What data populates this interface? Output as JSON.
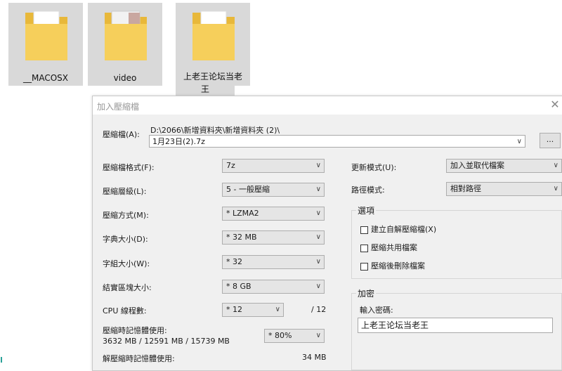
{
  "desktop": {
    "folders": [
      {
        "name": "__MACOSX"
      },
      {
        "name": "video"
      },
      {
        "name": "上老王论坛当老",
        "name_line2": "王"
      }
    ]
  },
  "dialog": {
    "title": "加入壓縮檔",
    "close_glyph": "✕",
    "archive_label": "壓縮檔(A):",
    "archive_path": "D:\\2066\\新增資料夾\\新增資料夾 (2)\\",
    "archive_name": "1月23日(2).7z",
    "browse_label": "...",
    "format_label": "壓縮檔格式(F):",
    "format_value": "7z",
    "level_label": "壓縮層級(L):",
    "level_value": "5 - 一般壓縮",
    "method_label": "壓縮方式(M):",
    "method_value": "* LZMA2",
    "dict_label": "字典大小(D):",
    "dict_value": "* 32 MB",
    "word_label": "字組大小(W):",
    "word_value": "* 32",
    "solid_label": "結實區塊大小:",
    "solid_value": "* 8 GB",
    "cpu_label": "CPU 線程數:",
    "cpu_value": "* 12",
    "cpu_total": "/ 12",
    "mem_label": "壓縮時記憶體使用:",
    "mem_detail": "3632 MB / 12591 MB / 15739 MB",
    "mem_value": "* 80%",
    "decomp_label": "解壓縮時記憶體使用:",
    "decomp_value": "34 MB",
    "update_label": "更新模式(U):",
    "update_value": "加入並取代檔案",
    "pathmode_label": "路徑模式:",
    "pathmode_value": "相對路徑",
    "options_title": "選項",
    "opt_sfx": "建立自解壓縮檔(X)",
    "opt_shared": "壓縮共用檔案",
    "opt_delete": "壓縮後刪除檔案",
    "encrypt_title": "加密",
    "password_label": "輸入密碼:",
    "password_value": "上老王论坛当老王"
  }
}
